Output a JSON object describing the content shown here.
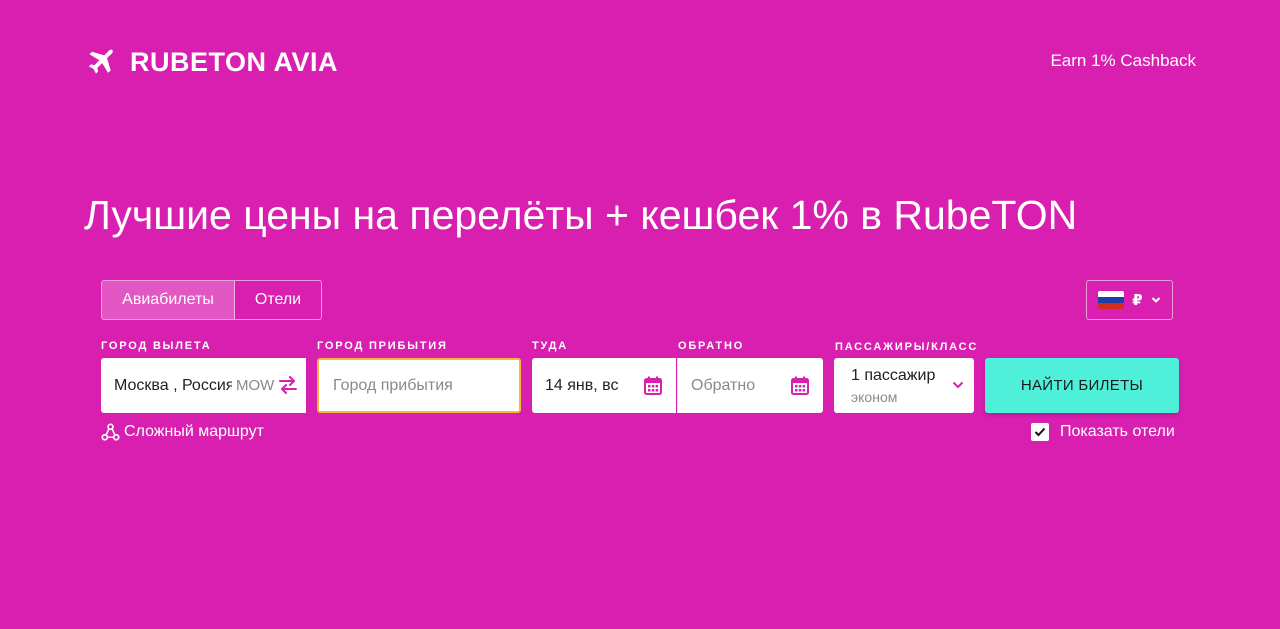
{
  "header": {
    "logo_text": "RUBETON AVIA",
    "logo_icon": "airplane-icon",
    "cashback_link": "Earn 1% Cashback"
  },
  "hero": {
    "title": "Лучшие цены на перелёты + кешбек 1% в RubeTON"
  },
  "tabs": [
    {
      "label": "Авиабилеты",
      "active": true
    },
    {
      "label": "Отели",
      "active": false
    }
  ],
  "currency": {
    "symbol": "₽",
    "flag": "russia-flag-icon"
  },
  "form": {
    "origin": {
      "label": "ГОРОД ВЫЛЕТА",
      "value": "Москва , Россия",
      "iata": "MOW"
    },
    "destination": {
      "label": "ГОРОД ПРИБЫТИЯ",
      "placeholder": "Город прибытия",
      "value": ""
    },
    "depart": {
      "label": "ТУДА",
      "value": "14 янв, вс"
    },
    "return": {
      "label": "ОБРАТНО",
      "placeholder": "Обратно"
    },
    "passengers": {
      "label": "ПАССАЖИРЫ/КЛАСС",
      "count": "1 пассажир",
      "class": "эконом"
    },
    "search_button": "НАЙТИ БИЛЕТЫ",
    "multi_route": "Сложный маршрут",
    "show_hotels": {
      "label": "Показать отели",
      "checked": true
    }
  },
  "colors": {
    "background": "#d81fb0",
    "search_button": "#4ef0d9",
    "destination_focus_border": "#f6b93b",
    "icon_accent": "#d81fb0"
  }
}
